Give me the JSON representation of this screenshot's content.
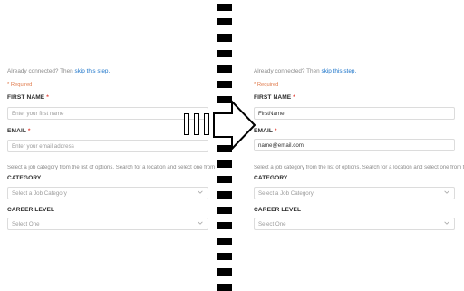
{
  "left": {
    "connected_text": "Already connected? Then",
    "skip_link": "skip this step.",
    "required_note": "* Required",
    "first_name_label": "FIRST NAME",
    "required_star": "*",
    "first_name_placeholder": "Enter your first name",
    "email_label": "EMAIL",
    "email_placeholder": "Enter your email address",
    "help_text": "Select a job category from the list of options. Search for a location and select one from the",
    "category_label": "CATEGORY",
    "category_placeholder": "Select a Job Category",
    "career_label": "CAREER LEVEL",
    "career_placeholder": "Select One"
  },
  "right": {
    "connected_text": "Already connected? Then",
    "skip_link": "skip this step.",
    "required_note": "* Required",
    "first_name_label": "FIRST NAME",
    "required_star": "*",
    "first_name_value": "FirstName",
    "email_label": "EMAIL",
    "email_value": "name@email.com",
    "help_text": "Select a job category from the list of options. Search for a location and select one from the l",
    "category_label": "CATEGORY",
    "category_placeholder": "Select a Job Category",
    "career_label": "CAREER LEVEL",
    "career_placeholder": "Select One"
  },
  "icons": {
    "arrow": "right-arrow-icon",
    "chevron": "chevron-down-icon",
    "divider": "dashed-divider"
  }
}
